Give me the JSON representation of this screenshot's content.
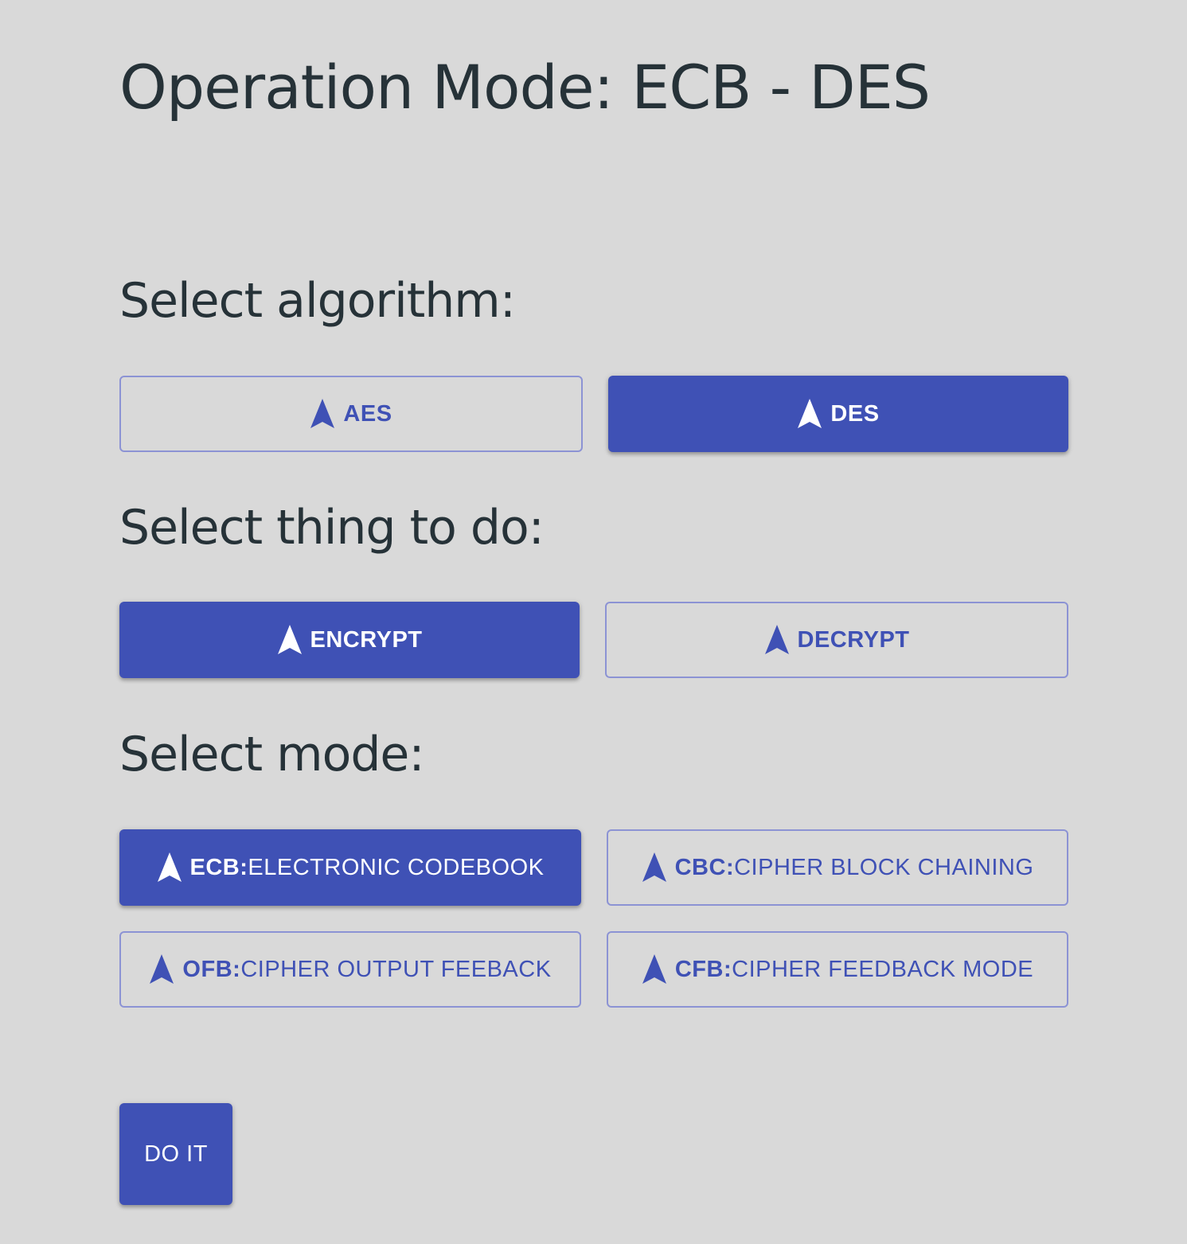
{
  "title": "Operation Mode: ECB - DES",
  "algorithm": {
    "heading": "Select algorithm:",
    "options": [
      {
        "label": "AES",
        "selected": false,
        "icon": "navigation-arrow-icon"
      },
      {
        "label": "DES",
        "selected": true,
        "icon": "navigation-arrow-icon"
      }
    ]
  },
  "action": {
    "heading": "Select thing to do:",
    "options": [
      {
        "label": "ENCRYPT",
        "selected": true,
        "icon": "navigation-arrow-icon"
      },
      {
        "label": "DECRYPT",
        "selected": false,
        "icon": "navigation-arrow-icon"
      }
    ]
  },
  "mode": {
    "heading": "Select mode:",
    "separator": ":",
    "options": [
      {
        "code": "ECB",
        "description": "ELECTRONIC CODEBOOK",
        "selected": true,
        "icon": "navigation-arrow-icon"
      },
      {
        "code": "CBC",
        "description": "CIPHER BLOCK CHAINING",
        "selected": false,
        "icon": "navigation-arrow-icon"
      },
      {
        "code": "OFB",
        "description": "CIPHER OUTPUT FEEBACK",
        "selected": false,
        "icon": "navigation-arrow-icon"
      },
      {
        "code": "CFB",
        "description": "CIPHER FEEDBACK MODE",
        "selected": false,
        "icon": "navigation-arrow-icon"
      }
    ]
  },
  "submit": {
    "label": "DO IT"
  },
  "colors": {
    "background": "#d9d9d9",
    "primary": "#3f51b5",
    "outline": "#8c93d4",
    "text": "#263238",
    "on_primary": "#ffffff"
  }
}
